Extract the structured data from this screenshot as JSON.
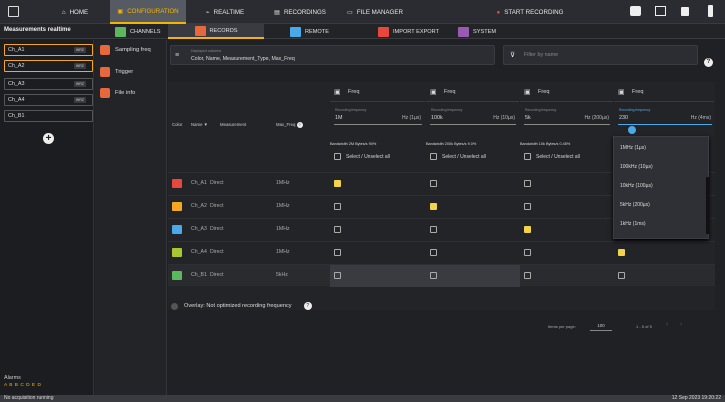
{
  "topnav": [
    {
      "label": "HOME",
      "icon": "home-icon"
    },
    {
      "label": "CONFIGURATION",
      "icon": "config-icon",
      "active": true
    },
    {
      "label": "REALTIME",
      "icon": "realtime-icon"
    },
    {
      "label": "RECORDINGS",
      "icon": "recordings-icon"
    },
    {
      "label": "FILE MANAGER",
      "icon": "folder-icon"
    },
    {
      "label": "START RECORDING",
      "icon": "record-dot-icon"
    }
  ],
  "subnav": {
    "title": "Measurements realtime",
    "items": [
      {
        "label": "CHANNELS"
      },
      {
        "label": "RECORDS",
        "active": true
      },
      {
        "label": "REMOTE"
      },
      {
        "label": "IMPORT EXPORT"
      },
      {
        "label": "SYSTEM"
      }
    ]
  },
  "channels": [
    {
      "name": "Ch_A1",
      "tag": "WRZ"
    },
    {
      "name": "Ch_A2",
      "tag": "WRZ"
    },
    {
      "name": "Ch_A3",
      "tag": "WRZ"
    },
    {
      "name": "Ch_A4",
      "tag": "WRZ"
    },
    {
      "name": "Ch_B1",
      "tag": ""
    }
  ],
  "alarms": {
    "label": "Alarms",
    "letters": "A B B C D E D"
  },
  "status": {
    "left": "No acquisition running",
    "right": "12 Sep 2023 19:20:22"
  },
  "settings": [
    {
      "label": "Sampling freq"
    },
    {
      "label": "Trigger"
    },
    {
      "label": "File info"
    }
  ],
  "columns_box": {
    "caption": "Displayed columns",
    "value": "Color, Name, Measurement_Type, Max_Freq"
  },
  "filter": {
    "placeholder": "Filter by name"
  },
  "table": {
    "headers": [
      "Color",
      "Name",
      "Measurement",
      "Max_Freq"
    ],
    "sort_marker": "▼",
    "freq_cols": [
      {
        "title": "Freq",
        "caption": "Recording frequency",
        "value": "1M",
        "unit": "Hz (1µs)",
        "bandwidth": "Bandwidth 2M Bytes/s 90%",
        "sel": "Select / Unselect all"
      },
      {
        "title": "Freq",
        "caption": "Recording frequency",
        "value": "100k",
        "unit": "Hz (10µs)",
        "bandwidth": "Bandwidth 200k Bytes/s 9.0%",
        "sel": "Select / Unselect all"
      },
      {
        "title": "Freq",
        "caption": "Recording frequency",
        "value": "5k",
        "unit": "Hz (200µs)",
        "bandwidth": "Bandwidth 10k Bytes/s 0.45%",
        "sel": "Select / Unselect all"
      },
      {
        "title": "Freq",
        "caption": "Recording frequency",
        "value": "230",
        "unit": "Hz (4ms)"
      }
    ],
    "rows": [
      {
        "color": "#e8473d",
        "name": "Ch_A1",
        "meas": "Direct",
        "max": "1MHz",
        "checks": [
          true,
          false,
          false,
          false
        ]
      },
      {
        "color": "#f5a623",
        "name": "Ch_A2",
        "meas": "Direct",
        "max": "1MHz",
        "checks": [
          false,
          true,
          false,
          false
        ]
      },
      {
        "color": "#4aa9e9",
        "name": "Ch_A3",
        "meas": "Direct",
        "max": "1MHz",
        "checks": [
          false,
          false,
          true,
          false
        ]
      },
      {
        "color": "#a8c832",
        "name": "Ch_A4",
        "meas": "Direct",
        "max": "1MHz",
        "checks": [
          false,
          false,
          false,
          true
        ]
      },
      {
        "color": "#5cb85c",
        "name": "Ch_B1",
        "meas": "Direct",
        "max": "5kHz",
        "checks": [
          false,
          false,
          false,
          false
        ]
      }
    ],
    "pager": {
      "label": "Items per page:",
      "value": "100",
      "range": "1 - 5 of 5"
    }
  },
  "dropdown": [
    "1MHz (1µs)",
    "100kHz (10µs)",
    "10kHz (100µs)",
    "5kHz (200µs)",
    "1kHz (1ms)"
  ],
  "overlay": "Overlay: Not optimized recording frequency"
}
